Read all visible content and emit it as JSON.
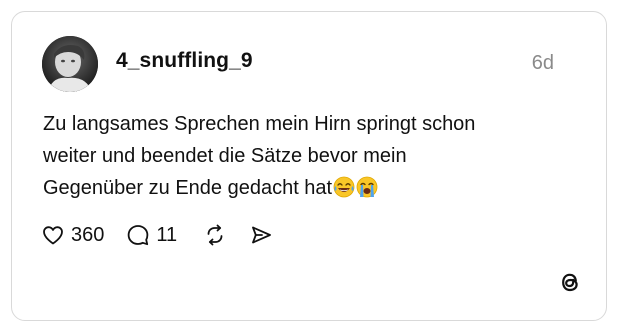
{
  "post": {
    "username": "4_snuffling_9",
    "time_ago": "6d",
    "text_lines": [
      "Zu langsames Sprechen mein Hirn springt schon",
      "weiter und beendet die Sätze bevor mein",
      "Gegenüber zu Ende gedacht hat"
    ],
    "emojis": [
      "laughing-tears-emoji",
      "crying-emoji"
    ],
    "likes": "360",
    "replies": "11"
  },
  "icons": {
    "like": "heart-icon",
    "reply": "comment-bubble-icon",
    "repost": "repost-icon",
    "share": "send-icon",
    "brand": "threads-logo-icon"
  },
  "colors": {
    "background": "#ffffff",
    "border": "#d9d9d9",
    "text": "#111111",
    "muted": "#8a8a8a"
  }
}
